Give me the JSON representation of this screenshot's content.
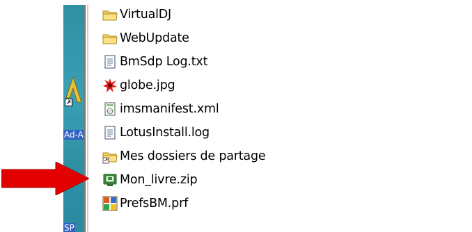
{
  "desktop": {
    "label_partial_top": "Ad-A",
    "label_partial_bottom": "SP",
    "shortcut_arrow": "↗"
  },
  "explorer": {
    "files": [
      {
        "name": "VirtualDJ",
        "icon": "folder-icon"
      },
      {
        "name": "WebUpdate",
        "icon": "folder-icon"
      },
      {
        "name": "BmSdp Log.txt",
        "icon": "text-file-icon"
      },
      {
        "name": "globe.jpg",
        "icon": "image-splat-icon"
      },
      {
        "name": "imsmanifest.xml",
        "icon": "xml-file-icon"
      },
      {
        "name": "LotusInstall.log",
        "icon": "text-file-icon"
      },
      {
        "name": "Mes dossiers de partage",
        "icon": "shared-folder-icon"
      },
      {
        "name": "Mon_livre.zip",
        "icon": "zip-archive-icon"
      },
      {
        "name": "PrefsBM.prf",
        "icon": "prf-file-icon"
      }
    ]
  },
  "annotation": {
    "arrow_color": "#e00000",
    "points_to": "Mon_livre.zip"
  }
}
